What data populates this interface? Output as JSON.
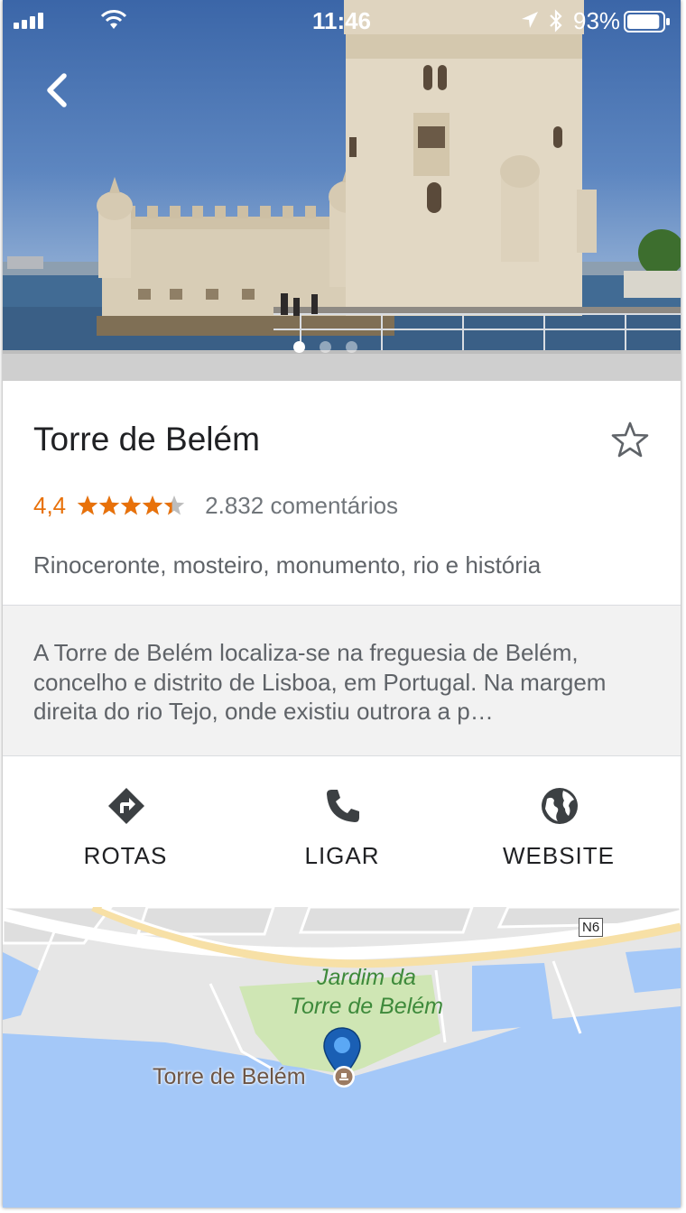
{
  "status_bar": {
    "time": "11:46",
    "battery_percent": "93%",
    "battery_level": 0.93
  },
  "hero": {
    "page_dots": 3,
    "active_dot": 0
  },
  "place": {
    "name": "Torre de Belém",
    "rating": "4,4",
    "rating_value": 4.4,
    "reviews": "2.832 comentários",
    "category": "Rinoceronte, mosteiro, monumento, rio e história",
    "description": "A Torre de Belém localiza-se na freguesia de Belém, concelho e distrito de Lisboa, em Portugal. Na margem direita do rio Tejo, onde existiu outrora a p…"
  },
  "actions": [
    {
      "label": "ROTAS",
      "icon": "directions-icon"
    },
    {
      "label": "LIGAR",
      "icon": "phone-icon"
    },
    {
      "label": "WEBSITE",
      "icon": "globe-icon"
    }
  ],
  "map": {
    "park_label": "Jardim da Torre de Belém",
    "poi_label": "Torre de Belém",
    "road_shield": "N6"
  },
  "colors": {
    "rating": "#e8710a",
    "water": "#a4c8f8",
    "park": "#cfe6b4",
    "pin": "#1a73e8"
  }
}
